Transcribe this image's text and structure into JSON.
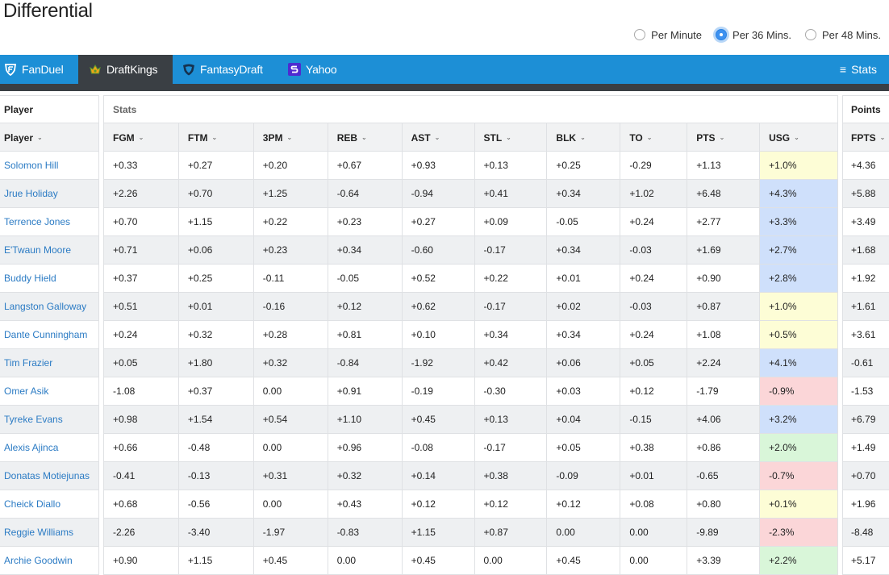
{
  "page": {
    "title": "Differential"
  },
  "modes": [
    {
      "label": "Per Minute",
      "selected": false
    },
    {
      "label": "Per 36 Mins.",
      "selected": true
    },
    {
      "label": "Per 48 Mins.",
      "selected": false
    }
  ],
  "sites": [
    {
      "label": "FanDuel",
      "icon": "fanduel-shield-icon"
    },
    {
      "label": "DraftKings",
      "icon": "draftkings-crown-icon"
    },
    {
      "label": "FantasyDraft",
      "icon": "fantasydraft-shield-icon"
    },
    {
      "label": "Yahoo",
      "icon": "yahoo-s-icon"
    }
  ],
  "active_site": "DraftKings",
  "stats_menu": {
    "label": "Stats",
    "icon": "hamburger-menu-icon"
  },
  "table": {
    "groups": {
      "player": "Player",
      "stats": "Stats",
      "points": "Points"
    },
    "player_header": "Player",
    "stat_headers": [
      "FGM",
      "FTM",
      "3PM",
      "REB",
      "AST",
      "STL",
      "BLK",
      "TO",
      "PTS",
      "USG"
    ],
    "points_header": "FPTS",
    "usg_colors": {
      "yellow": "#fdfdd6",
      "blue": "#cfe0fb",
      "red": "#fbd6d8",
      "green": "#d9f6d9"
    },
    "rows": [
      {
        "player": "Solomon Hill",
        "stats": [
          "+0.33",
          "+0.27",
          "+0.20",
          "+0.67",
          "+0.93",
          "+0.13",
          "+0.25",
          "-0.29",
          "+1.13",
          "+1.0%"
        ],
        "usg_color": "yellow",
        "fpts": "+4.36"
      },
      {
        "player": "Jrue Holiday",
        "stats": [
          "+2.26",
          "+0.70",
          "+1.25",
          "-0.64",
          "-0.94",
          "+0.41",
          "+0.34",
          "+1.02",
          "+6.48",
          "+4.3%"
        ],
        "usg_color": "blue",
        "fpts": "+5.88"
      },
      {
        "player": "Terrence Jones",
        "stats": [
          "+0.70",
          "+1.15",
          "+0.22",
          "+0.23",
          "+0.27",
          "+0.09",
          "-0.05",
          "+0.24",
          "+2.77",
          "+3.3%"
        ],
        "usg_color": "blue",
        "fpts": "+3.49"
      },
      {
        "player": "E'Twaun Moore",
        "stats": [
          "+0.71",
          "+0.06",
          "+0.23",
          "+0.34",
          "-0.60",
          "-0.17",
          "+0.34",
          "-0.03",
          "+1.69",
          "+2.7%"
        ],
        "usg_color": "blue",
        "fpts": "+1.68"
      },
      {
        "player": "Buddy Hield",
        "stats": [
          "+0.37",
          "+0.25",
          "-0.11",
          "-0.05",
          "+0.52",
          "+0.22",
          "+0.01",
          "+0.24",
          "+0.90",
          "+2.8%"
        ],
        "usg_color": "blue",
        "fpts": "+1.92"
      },
      {
        "player": "Langston Galloway",
        "stats": [
          "+0.51",
          "+0.01",
          "-0.16",
          "+0.12",
          "+0.62",
          "-0.17",
          "+0.02",
          "-0.03",
          "+0.87",
          "+1.0%"
        ],
        "usg_color": "yellow",
        "fpts": "+1.61"
      },
      {
        "player": "Dante Cunningham",
        "stats": [
          "+0.24",
          "+0.32",
          "+0.28",
          "+0.81",
          "+0.10",
          "+0.34",
          "+0.34",
          "+0.24",
          "+1.08",
          "+0.5%"
        ],
        "usg_color": "yellow",
        "fpts": "+3.61"
      },
      {
        "player": "Tim Frazier",
        "stats": [
          "+0.05",
          "+1.80",
          "+0.32",
          "-0.84",
          "-1.92",
          "+0.42",
          "+0.06",
          "+0.05",
          "+2.24",
          "+4.1%"
        ],
        "usg_color": "blue",
        "fpts": "-0.61"
      },
      {
        "player": "Omer Asik",
        "stats": [
          "-1.08",
          "+0.37",
          "0.00",
          "+0.91",
          "-0.19",
          "-0.30",
          "+0.03",
          "+0.12",
          "-1.79",
          "-0.9%"
        ],
        "usg_color": "red",
        "fpts": "-1.53"
      },
      {
        "player": "Tyreke Evans",
        "stats": [
          "+0.98",
          "+1.54",
          "+0.54",
          "+1.10",
          "+0.45",
          "+0.13",
          "+0.04",
          "-0.15",
          "+4.06",
          "+3.2%"
        ],
        "usg_color": "blue",
        "fpts": "+6.79"
      },
      {
        "player": "Alexis Ajinca",
        "stats": [
          "+0.66",
          "-0.48",
          "0.00",
          "+0.96",
          "-0.08",
          "-0.17",
          "+0.05",
          "+0.38",
          "+0.86",
          "+2.0%"
        ],
        "usg_color": "green",
        "fpts": "+1.49"
      },
      {
        "player": "Donatas Motiejunas",
        "stats": [
          "-0.41",
          "-0.13",
          "+0.31",
          "+0.32",
          "+0.14",
          "+0.38",
          "-0.09",
          "+0.01",
          "-0.65",
          "-0.7%"
        ],
        "usg_color": "red",
        "fpts": "+0.70"
      },
      {
        "player": "Cheick Diallo",
        "stats": [
          "+0.68",
          "-0.56",
          "0.00",
          "+0.43",
          "+0.12",
          "+0.12",
          "+0.12",
          "+0.08",
          "+0.80",
          "+0.1%"
        ],
        "usg_color": "yellow",
        "fpts": "+1.96"
      },
      {
        "player": "Reggie Williams",
        "stats": [
          "-2.26",
          "-3.40",
          "-1.97",
          "-0.83",
          "+1.15",
          "+0.87",
          "0.00",
          "0.00",
          "-9.89",
          "-2.3%"
        ],
        "usg_color": "red",
        "fpts": "-8.48"
      },
      {
        "player": "Archie Goodwin",
        "stats": [
          "+0.90",
          "+1.15",
          "+0.45",
          "0.00",
          "+0.45",
          "0.00",
          "+0.45",
          "0.00",
          "+3.39",
          "+2.2%"
        ],
        "usg_color": "green",
        "fpts": "+5.17"
      }
    ]
  }
}
